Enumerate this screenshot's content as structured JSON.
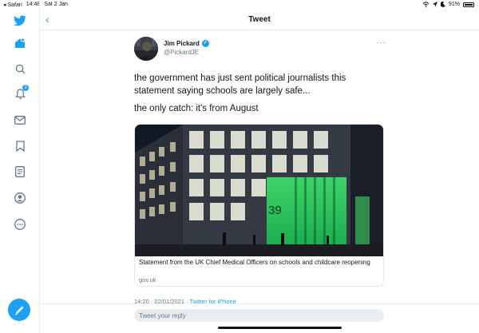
{
  "status_bar": {
    "back_app": "◂ Safari",
    "time": "14:48",
    "date": "Sat 2 Jan",
    "battery": "91%",
    "icons": [
      "wifi-icon",
      "location-icon",
      "moon-icon",
      "battery-icon"
    ]
  },
  "sidebar": {
    "items": [
      {
        "name": "twitter-logo-icon"
      },
      {
        "name": "home-icon"
      },
      {
        "name": "search-icon"
      },
      {
        "name": "notifications-icon",
        "badge": "3"
      },
      {
        "name": "messages-icon"
      },
      {
        "name": "bookmarks-icon"
      },
      {
        "name": "lists-icon"
      },
      {
        "name": "profile-icon"
      },
      {
        "name": "more-icon"
      }
    ],
    "compose": "compose-icon"
  },
  "header": {
    "title": "Tweet",
    "back": "‹"
  },
  "tweet": {
    "author_name": "Jim Pickard",
    "handle": "@PickardJE",
    "text_line1": "the government has just sent political journalists this statement saying schools are largely safe...",
    "text_line2": "the only catch: it's from August",
    "more": "···",
    "card": {
      "title": "Statement from the UK Chief Medical Officers on schools and childcare reopening",
      "domain": "gov.uk",
      "image_alt": "Office building at night with green-lit entrance numbered 39",
      "building_number": "39"
    },
    "timestamp": "14:20 · 02/01/2021 · ",
    "source": "Twitter for iPhone"
  },
  "reply": {
    "placeholder": "Tweet your reply"
  },
  "colors": {
    "accent": "#1da1f2",
    "text": "#14171a",
    "muted": "#657786",
    "border": "#e6ecf0"
  }
}
